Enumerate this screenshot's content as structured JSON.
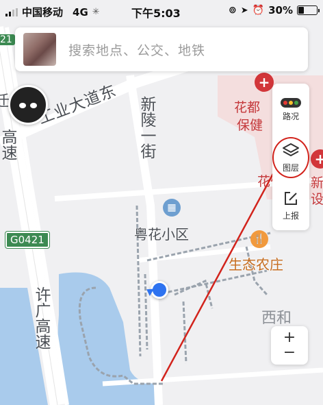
{
  "status_bar": {
    "carrier": "中国移动",
    "network": "4G",
    "time": "下午5:03",
    "battery": "30%",
    "battery_level": 0.3
  },
  "search": {
    "placeholder": "搜索地点、公交、地铁"
  },
  "tools": {
    "traffic_label": "路况",
    "layers_label": "图层",
    "report_label": "上报"
  },
  "zoom": {
    "in": "+",
    "out": "−"
  },
  "map": {
    "roads": {
      "gongye": "工业大道东",
      "xinling": "新陵一街",
      "xuguang": "许广高速",
      "gaosu_top": "高速",
      "g0421": "G0421",
      "num21": "21",
      "fragment_zheng": "迁"
    },
    "places": {
      "yuehua": "粤花小区",
      "shengtai": "生态农庄",
      "xihe": "西和",
      "huadu": "花都",
      "baojian": "保健",
      "hua2": "花",
      "xin": "新",
      "she": "设"
    }
  },
  "colors": {
    "accent": "#d2231c",
    "water": "#a9cbec",
    "road": "#ffffff",
    "poi_blue": "#6e9fd0",
    "poi_orange": "#f19a3e",
    "location": "#2e73f0"
  }
}
